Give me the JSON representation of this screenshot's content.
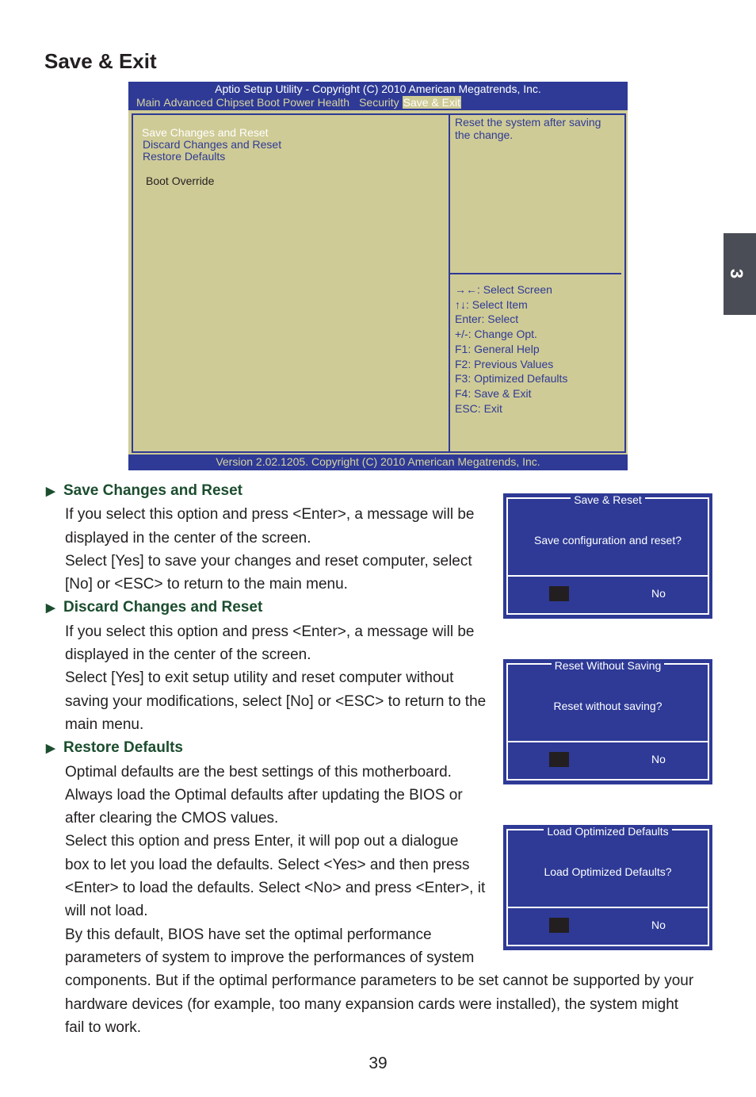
{
  "title": "Save & Exit",
  "bios": {
    "header": "Aptio Setup Utility - Copyright (C) 2010 American Megatrends, Inc.",
    "menu": [
      "Main",
      "Advanced",
      "Chipset",
      "Boot",
      "Power",
      "Health",
      "Security",
      "Save & Exit"
    ],
    "active_menu": "Save & Exit",
    "items": [
      "Save Changes and Reset",
      "Discard Changes and Reset",
      "Restore Defaults",
      "Boot Override"
    ],
    "help": "Reset the system after saving the change.",
    "keys": [
      "→←: Select Screen",
      "↑↓: Select Item",
      "Enter: Select",
      "+/-: Change Opt.",
      "F1: General Help",
      "F2: Previous Values",
      "F3: Optimized Defaults",
      "F4: Save & Exit",
      "ESC: Exit"
    ],
    "footer": "Version 2.02.1205. Copyright (C) 2010 American Megatrends, Inc.",
    "colors": {
      "background": "#cfcb96",
      "accent": "#2e3a96"
    }
  },
  "sections": [
    {
      "heading": "Save Changes and Reset",
      "lines": [
        "If you select this option and press <Enter>, a message will be",
        "displayed in the center of the screen.",
        "Select [Yes] to save your changes and reset computer, select",
        "[No] or <ESC> to return to the main menu."
      ]
    },
    {
      "heading": "Discard Changes and Reset",
      "lines": [
        "If you select this option and press <Enter>,  a message will be",
        "displayed in the center of the screen.",
        "Select [Yes] to exit setup utility and reset computer without",
        "saving your modifications, select [No] or <ESC> to return to the",
        "main menu."
      ]
    },
    {
      "heading": "Restore Defaults",
      "lines": [
        "Optimal defaults are the best settings of this motherboard.",
        "Always load the Optimal defaults after updating the BIOS or",
        "after clearing the CMOS values.",
        "Select this option and press Enter, it will pop out a dialogue",
        "box to let you load the defaults. Select <Yes> and then press",
        "<Enter> to load the defaults. Select <No> and press <Enter>, it",
        "will not load.",
        "By this default, BIOS have set the optimal performance",
        "parameters of system to improve the performances of system",
        "components. But if the optimal performance parameters to be set cannot be supported by your",
        "hardware devices (for example, too many expansion cards were installed), the system might",
        "fail to work."
      ]
    }
  ],
  "dialogs": [
    {
      "title": "Save & Reset",
      "message": "Save configuration and reset?",
      "no": "No"
    },
    {
      "title": "Reset Without Saving",
      "message": "Reset without saving?",
      "no": "No"
    },
    {
      "title": "Load Optimized Defaults",
      "message": "Load Optimized Defaults?",
      "no": "No"
    }
  ],
  "chapter_tab": "3",
  "page_number": "39"
}
